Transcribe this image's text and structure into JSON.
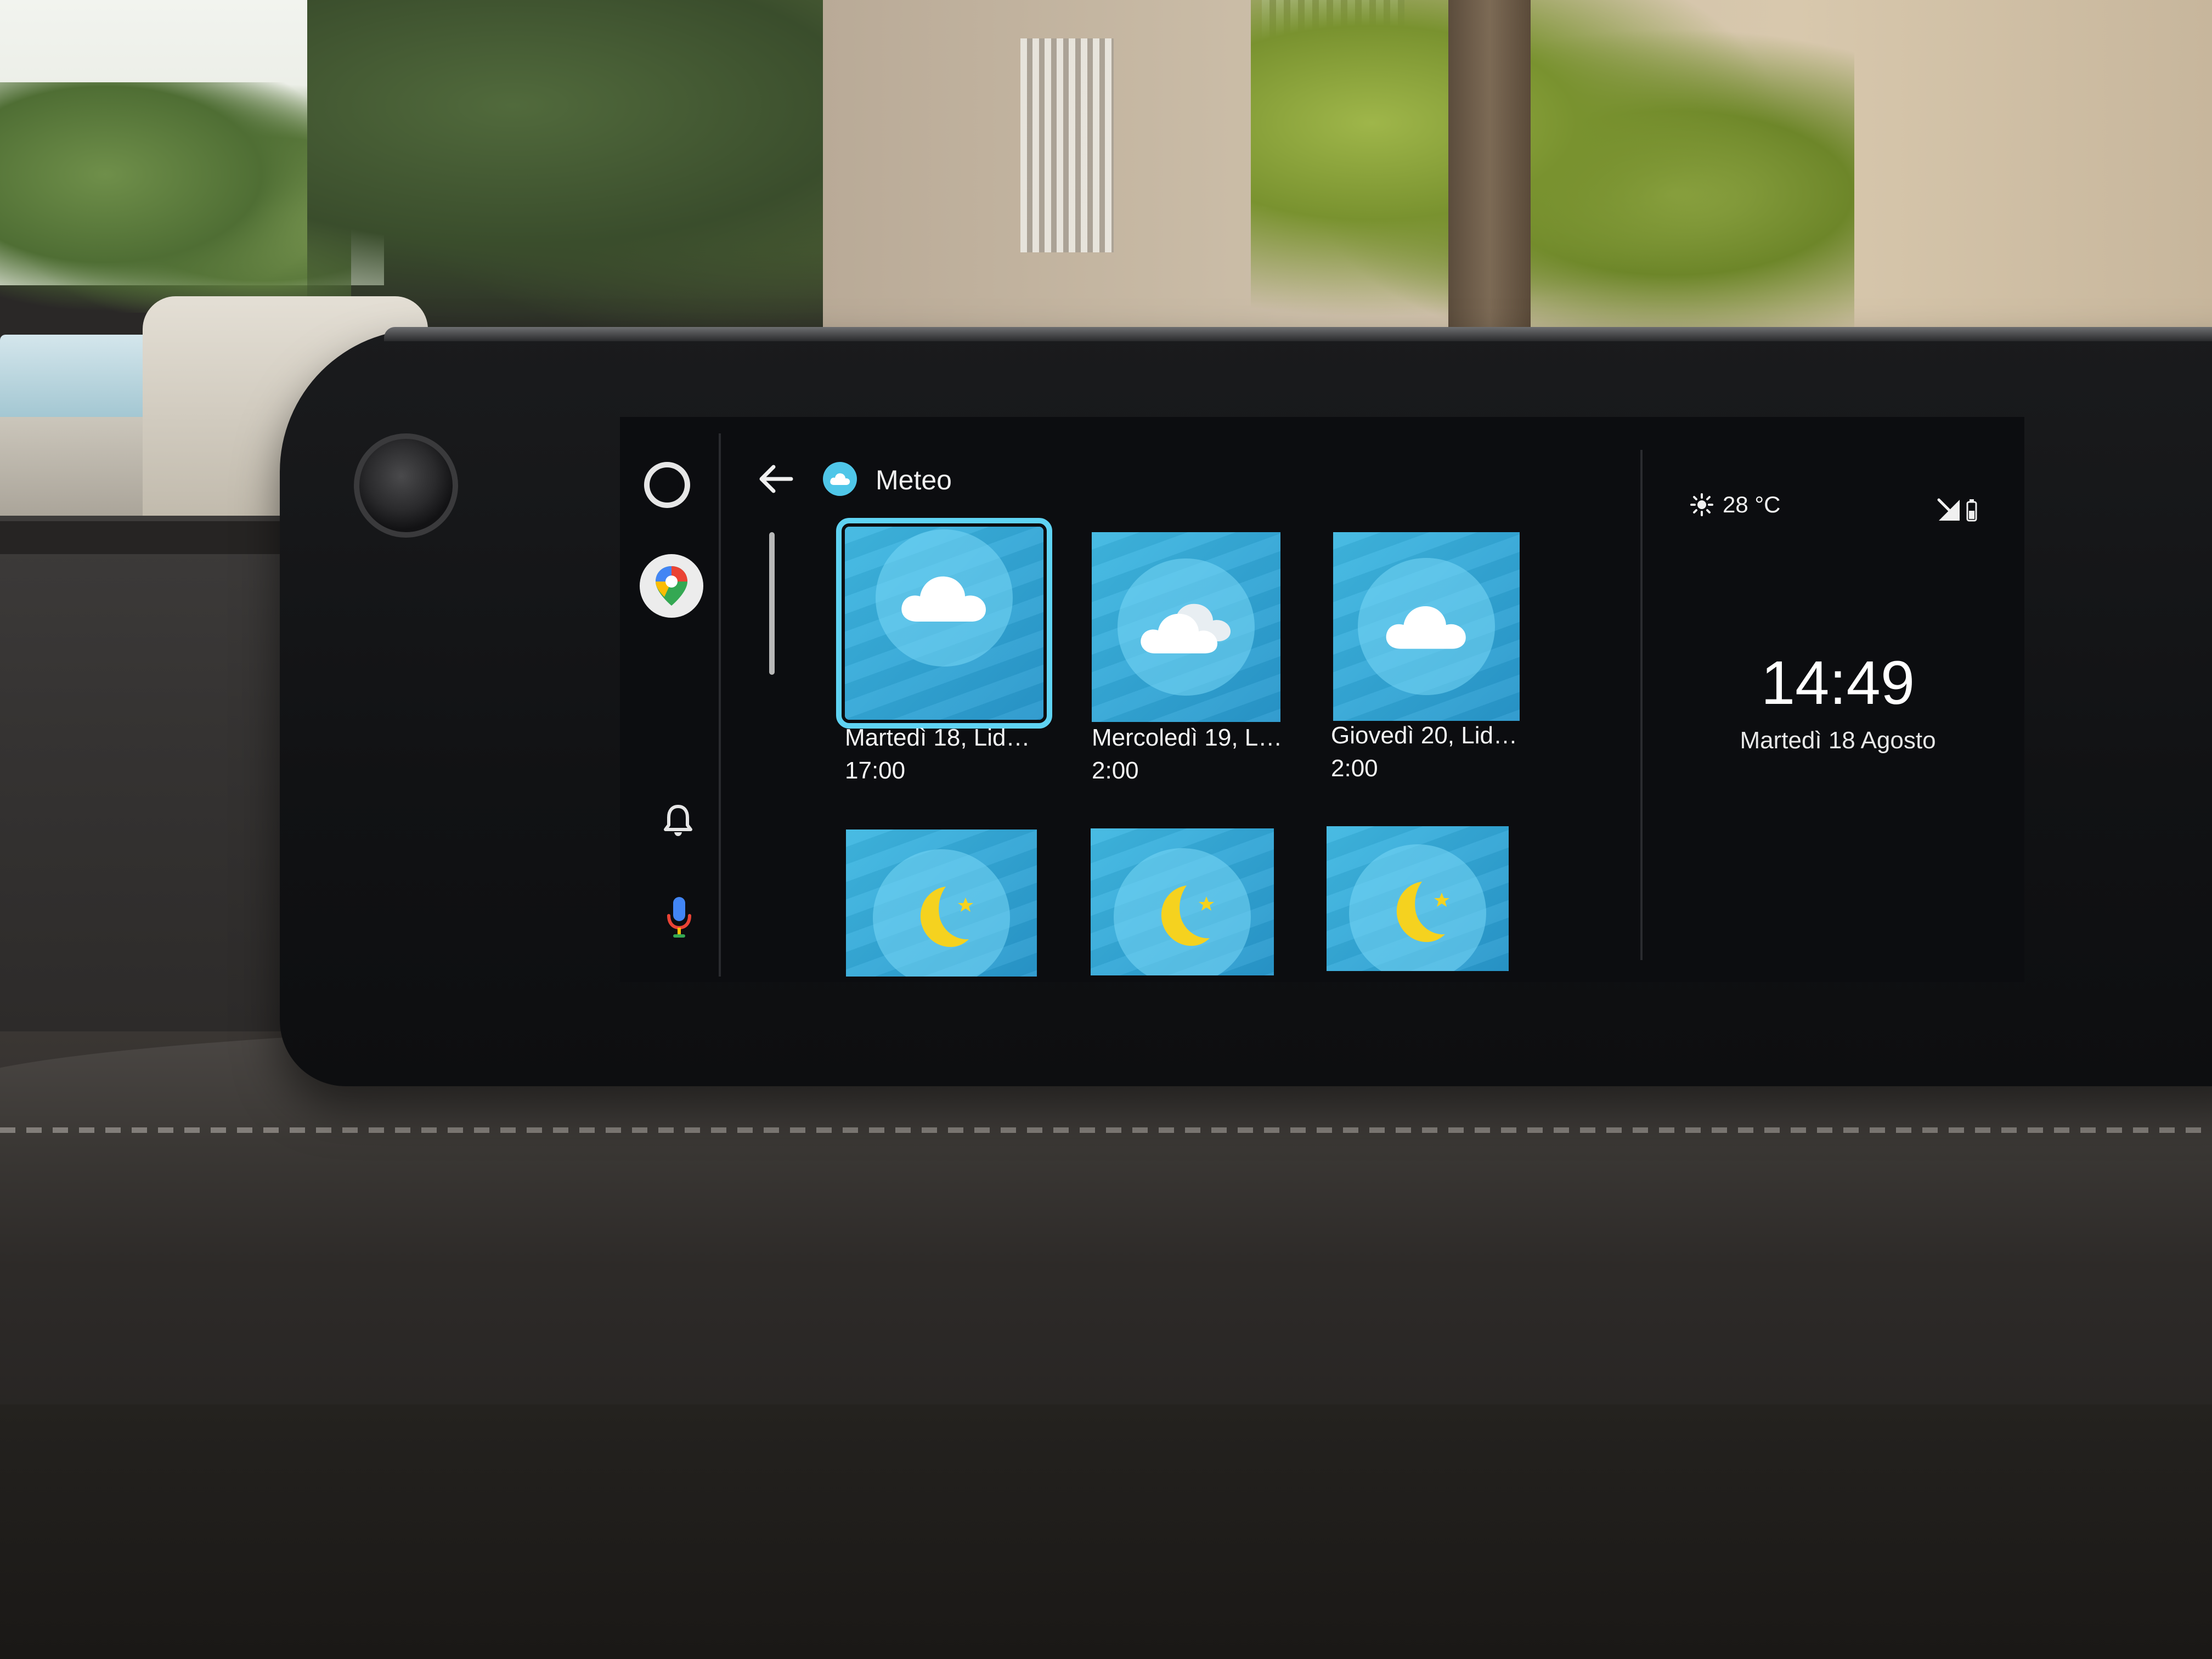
{
  "header": {
    "app_title": "Meteo"
  },
  "rail": {
    "icons": [
      "home-icon",
      "maps-icon",
      "bell-icon",
      "mic-icon"
    ]
  },
  "forecast": [
    {
      "title": "Martedì 18, Lid…",
      "time": "17:00",
      "icon": "cloud-icon",
      "selected": true
    },
    {
      "title": "Mercoledì 19, L…",
      "time": "2:00",
      "icon": "clouds-icon",
      "selected": false
    },
    {
      "title": "Giovedì 20, Lid…",
      "time": "2:00",
      "icon": "cloud-icon",
      "selected": false
    },
    {
      "title": "",
      "time": "",
      "icon": "moon-icon",
      "selected": false
    },
    {
      "title": "",
      "time": "",
      "icon": "moon-icon",
      "selected": false
    },
    {
      "title": "",
      "time": "",
      "icon": "moon-icon",
      "selected": false
    }
  ],
  "status": {
    "weather": "28 °C",
    "weather_icon": "sun-icon"
  },
  "clock": {
    "time": "14:49",
    "date": "Martedì 18 Agosto"
  },
  "colors": {
    "tile_blue": "#2fa9d8",
    "selection": "#5fd3f3",
    "moon_yellow": "#f5d21f"
  }
}
